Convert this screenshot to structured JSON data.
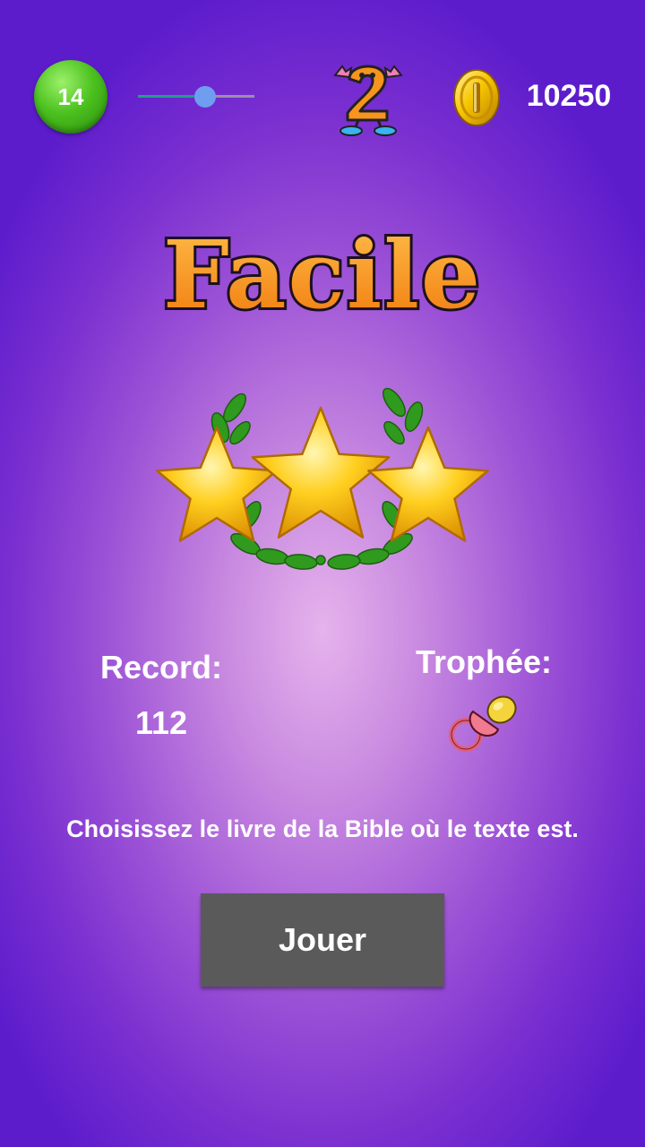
{
  "header": {
    "level": "14",
    "slider_fraction": 0.58,
    "coins": "10250",
    "mascot_icon": "number-2-mascot-icon",
    "coin_icon": "gold-coin-icon"
  },
  "mode": {
    "title": "Facile",
    "stars_earned": 3,
    "stars_total": 3
  },
  "stats": {
    "record_label": "Record:",
    "record_value": "112",
    "trophy_label": "Trophée:",
    "trophy_icon": "pacifier-icon"
  },
  "instruction": "Choisissez le livre de la Bible où le texte est.",
  "play_button": "Jouer",
  "colors": {
    "badge_green": "#4cc21f",
    "title_orange": "#f7941d",
    "star_gold": "#ffc21a",
    "button_gray": "#5a5a5a",
    "background_purple": "#7a2fd0"
  }
}
